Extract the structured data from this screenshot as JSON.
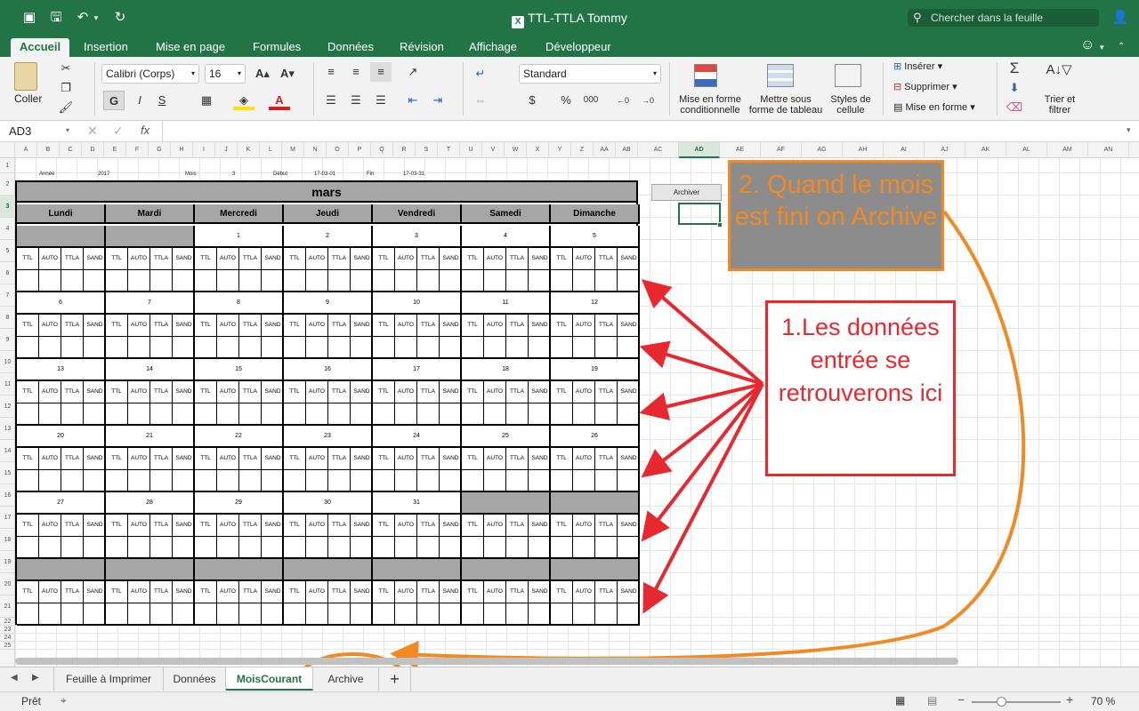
{
  "titlebar": {
    "title": "TTL-TTLA Tommy",
    "search_placeholder": "Chercher dans la feuille"
  },
  "ribbon_tabs": [
    "Accueil",
    "Insertion",
    "Mise en page",
    "Formules",
    "Données",
    "Révision",
    "Affichage",
    "Développeur"
  ],
  "ribbon": {
    "paste": "Coller",
    "font_name": "Calibri (Corps)",
    "font_size": "16",
    "bold": "G",
    "italic": "I",
    "underline": "S",
    "number_format": "Standard",
    "currency": "$",
    "percent": "%",
    "thousands": "000",
    "cond_format": [
      "Mise en forme",
      "conditionnelle"
    ],
    "table_format": [
      "Mettre sous",
      "forme de tableau"
    ],
    "cell_styles": [
      "Styles de",
      "cellule"
    ],
    "insert": "Insérer",
    "delete": "Supprimer",
    "format": "Mise en forme",
    "sort_filter": [
      "Trier et",
      "filtrer"
    ]
  },
  "formula_bar": {
    "cell_ref": "AD3",
    "fx": "fx",
    "value": ""
  },
  "columns": [
    "A",
    "B",
    "C",
    "D",
    "E",
    "F",
    "G",
    "H",
    "I",
    "J",
    "K",
    "L",
    "M",
    "N",
    "O",
    "P",
    "Q",
    "R",
    "S",
    "T",
    "U",
    "V",
    "W",
    "X",
    "Y",
    "Z",
    "AA",
    "AB",
    "AC",
    "AD",
    "AE",
    "AF",
    "AG",
    "AH",
    "AI",
    "AJ",
    "AK",
    "AL",
    "AM",
    "AN"
  ],
  "selected_column": "AD",
  "rows": [
    "1",
    "2",
    "3",
    "4",
    "5",
    "6",
    "7",
    "8",
    "9",
    "10",
    "11",
    "12",
    "13",
    "14",
    "15",
    "16",
    "17",
    "18",
    "19",
    "20",
    "21",
    "22",
    "23",
    "24",
    "25"
  ],
  "selected_row": "3",
  "row1": {
    "annee_label": "Année",
    "annee": "2017",
    "mois_label": "Mois",
    "mois": "3",
    "debut_label": "Début",
    "debut": "17-03-01",
    "fin_label": "Fin",
    "fin": "17-03-31"
  },
  "calendar": {
    "month": "mars",
    "days": [
      "Lundi",
      "Mardi",
      "Mercredi",
      "Jeudi",
      "Vendredi",
      "Samedi",
      "Dimanche"
    ],
    "subcols": [
      "TTL",
      "AUTO",
      "TTLA",
      "SAND"
    ],
    "weeks": [
      [
        "",
        "",
        "1",
        "2",
        "3",
        "4",
        "5"
      ],
      [
        "6",
        "7",
        "8",
        "9",
        "10",
        "11",
        "12"
      ],
      [
        "13",
        "14",
        "15",
        "16",
        "17",
        "18",
        "19"
      ],
      [
        "20",
        "21",
        "22",
        "23",
        "24",
        "25",
        "26"
      ],
      [
        "27",
        "28",
        "29",
        "30",
        "31",
        "",
        ""
      ],
      [
        "",
        "",
        "",
        "",
        "",
        "",
        ""
      ]
    ]
  },
  "archive_button": "Archiver",
  "annotations": {
    "callout1": "1.Les données entrée se retrouverons ici",
    "callout2": "2. Quand le mois est fini on Archive",
    "colors": {
      "red": "#e8282f",
      "orange": "#f18a22"
    }
  },
  "sheet_tabs": [
    "Feuille à Imprimer",
    "Données",
    "MoisCourant",
    "Archive"
  ],
  "active_sheet": "MoisCourant",
  "status": {
    "left": "Prêt",
    "zoom": "70 %"
  },
  "theme": {
    "excel_green": "#227447"
  }
}
